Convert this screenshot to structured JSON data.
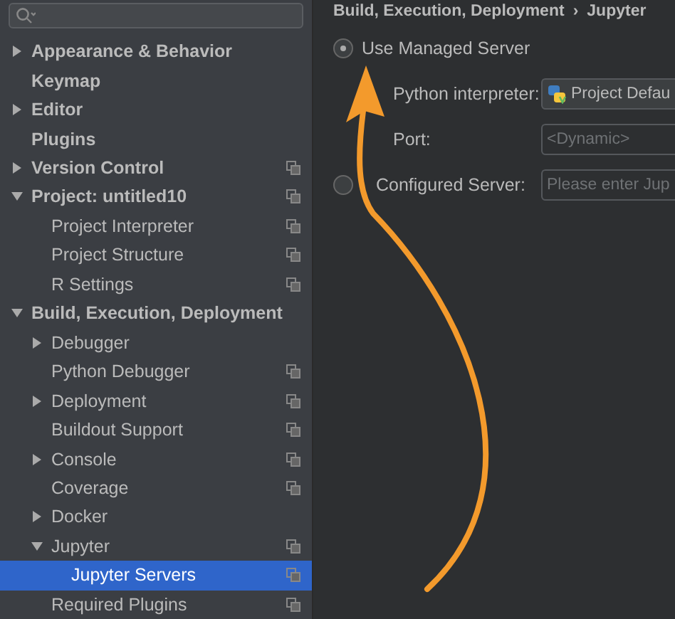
{
  "sidebar": {
    "search": {
      "has_field": true
    },
    "items": [
      {
        "label": "Appearance & Behavior",
        "kind": "group",
        "expanded": false,
        "selected": false,
        "project_scoped": false
      },
      {
        "label": "Keymap",
        "kind": "page",
        "selected": false,
        "project_scoped": false
      },
      {
        "label": "Editor",
        "kind": "group",
        "expanded": false,
        "selected": false,
        "project_scoped": false
      },
      {
        "label": "Plugins",
        "kind": "page",
        "selected": false,
        "project_scoped": false
      },
      {
        "label": "Version Control",
        "kind": "group",
        "expanded": false,
        "selected": false,
        "project_scoped": true
      },
      {
        "label": "Project: untitled10",
        "kind": "group",
        "expanded": true,
        "selected": false,
        "project_scoped": true,
        "children": [
          {
            "label": "Project Interpreter",
            "kind": "page",
            "selected": false,
            "project_scoped": true
          },
          {
            "label": "Project Structure",
            "kind": "page",
            "selected": false,
            "project_scoped": true
          },
          {
            "label": "R Settings",
            "kind": "page",
            "selected": false,
            "project_scoped": true
          }
        ]
      },
      {
        "label": "Build, Execution, Deployment",
        "kind": "group",
        "expanded": true,
        "selected": false,
        "project_scoped": false,
        "children": [
          {
            "label": "Debugger",
            "kind": "group",
            "expanded": false,
            "selected": false,
            "project_scoped": false
          },
          {
            "label": "Python Debugger",
            "kind": "page",
            "selected": false,
            "project_scoped": true
          },
          {
            "label": "Deployment",
            "kind": "group",
            "expanded": false,
            "selected": false,
            "project_scoped": true
          },
          {
            "label": "Buildout Support",
            "kind": "page",
            "selected": false,
            "project_scoped": true
          },
          {
            "label": "Console",
            "kind": "group",
            "expanded": false,
            "selected": false,
            "project_scoped": true
          },
          {
            "label": "Coverage",
            "kind": "page",
            "selected": false,
            "project_scoped": true
          },
          {
            "label": "Docker",
            "kind": "group",
            "expanded": false,
            "selected": false,
            "project_scoped": false
          },
          {
            "label": "Jupyter",
            "kind": "group",
            "expanded": true,
            "selected": false,
            "project_scoped": true,
            "children": [
              {
                "label": "Jupyter Servers",
                "kind": "page",
                "selected": true,
                "project_scoped": true
              }
            ]
          },
          {
            "label": "Required Plugins",
            "kind": "page",
            "selected": false,
            "project_scoped": true
          }
        ]
      }
    ]
  },
  "breadcrumb": [
    "Build, Execution, Deployment",
    "›",
    "Jupyter"
  ],
  "form": [
    {
      "kind": "radio",
      "label": "Use Managed Server",
      "selected": true
    },
    {
      "kind": "dropdown",
      "label": "Python interpreter:",
      "value": "Project Defau"
    },
    {
      "kind": "field",
      "label": "Port:",
      "value": "<Dynamic>",
      "disabled": true
    },
    {
      "kind": "radio-field",
      "label": "Configured Server:",
      "selected": false,
      "placeholder": "Please enter Jup",
      "disabled": true
    }
  ]
}
